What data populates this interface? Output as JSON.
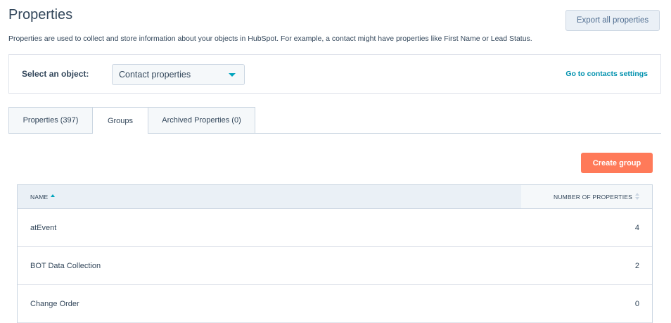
{
  "header": {
    "title": "Properties",
    "export_label": "Export all properties",
    "description": "Properties are used to collect and store information about your objects in HubSpot. For example, a contact might have properties like First Name or Lead Status."
  },
  "object_selector": {
    "label": "Select an object:",
    "selected": "Contact properties",
    "settings_link": "Go to contacts settings"
  },
  "tabs": [
    {
      "label": "Properties (397)",
      "active": false
    },
    {
      "label": "Groups",
      "active": true
    },
    {
      "label": "Archived Properties (0)",
      "active": false
    }
  ],
  "actions": {
    "create_group_label": "Create group"
  },
  "table": {
    "columns": {
      "name": "NAME",
      "count": "NUMBER OF PROPERTIES"
    },
    "rows": [
      {
        "name": "atEvent",
        "count": "4"
      },
      {
        "name": "BOT Data Collection",
        "count": "2"
      },
      {
        "name": "Change Order",
        "count": "0"
      }
    ]
  },
  "colors": {
    "accent": "#ff7a59",
    "link": "#0091ae",
    "text": "#33475b",
    "sort_active": "#00a4bd"
  }
}
